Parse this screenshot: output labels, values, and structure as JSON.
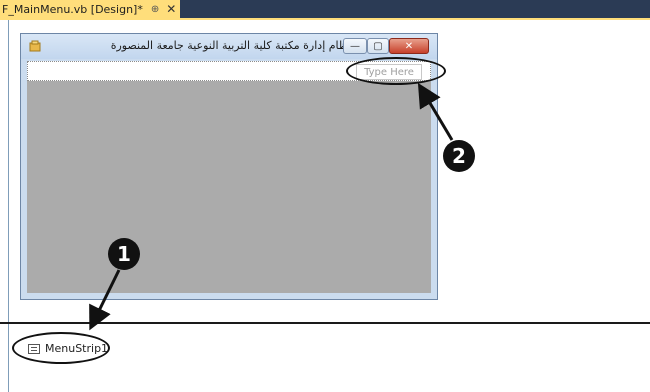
{
  "tab": {
    "title": "F_MainMenu.vb [Design]*",
    "pin": "⊕",
    "close": "✕"
  },
  "form": {
    "title": "نظام إدارة مكتبة كلية التربية النوعية جامعة المنصورة",
    "min_glyph": "—",
    "max_glyph": "▢",
    "close_glyph": "✕",
    "menu_placeholder": "Type Here"
  },
  "tray": {
    "component_label": "MenuStrip1"
  },
  "callouts": {
    "one": "1",
    "two": "2"
  }
}
